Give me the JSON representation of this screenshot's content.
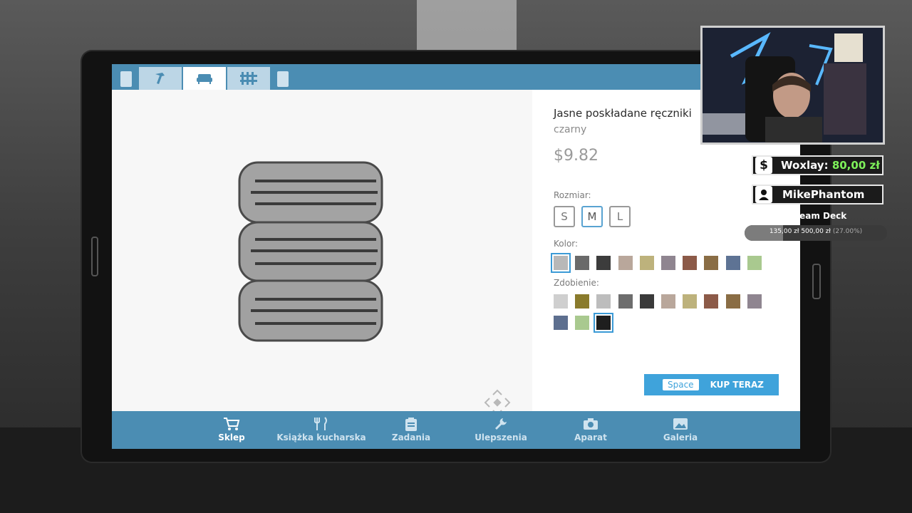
{
  "app": {
    "top_tabs": [
      {
        "icon": "hammer-icon"
      },
      {
        "icon": "sofa-icon",
        "active": true
      },
      {
        "icon": "fence-icon"
      }
    ]
  },
  "product": {
    "name": "Jasne poskładane ręczniki",
    "color_name": "czarny",
    "price": "$9.82",
    "size_label": "Rozmiar:",
    "sizes": [
      "S",
      "M",
      "L"
    ],
    "selected_size": "M",
    "color_label": "Kolor:",
    "colors": [
      "#b8b8b8",
      "#6a6a6a",
      "#3c3c3c",
      "#b9a79b",
      "#bdb27c",
      "#8f8590",
      "#8c5a48",
      "#8a6d45",
      "#5e7394",
      "#a9c98f"
    ],
    "selected_color_index": 0,
    "decor_label": "Zdobienie:",
    "decor_colors": [
      "#cfcfcf",
      "#8a7b2c",
      "#bdbdbd",
      "#6d6d6d",
      "#3a3a3a",
      "#b9a79b",
      "#bdb27c",
      "#8c5a48",
      "#8a6d45",
      "#8f8590",
      "#5d6f8f",
      "#a9c98f",
      "#1e1e1e"
    ],
    "selected_decor_index": 12
  },
  "buy": {
    "key": "Space",
    "label": "KUP TERAZ"
  },
  "nav": [
    {
      "label": "Sklep",
      "icon": "cart-icon",
      "active": true
    },
    {
      "label": "Książka kucharska",
      "icon": "cutlery-icon"
    },
    {
      "label": "Zadania",
      "icon": "clipboard-icon"
    },
    {
      "label": "Ulepszenia",
      "icon": "wrench-icon"
    },
    {
      "label": "Aparat",
      "icon": "camera-icon"
    },
    {
      "label": "Galeria",
      "icon": "image-icon"
    }
  ],
  "overlay": {
    "donor_name": "Woxlay:",
    "donor_amount": "80,00 zł",
    "subscriber": "MikePhantom",
    "goal_title": "Stream Deck",
    "goal_current": "135,00 zł",
    "goal_target": "500,00 zł",
    "goal_percent": "(27.00%)",
    "goal_fraction": 0.27
  },
  "colors": {
    "accent": "#4b8db3",
    "buy": "#3fa3db",
    "select": "#3b9ad6"
  }
}
